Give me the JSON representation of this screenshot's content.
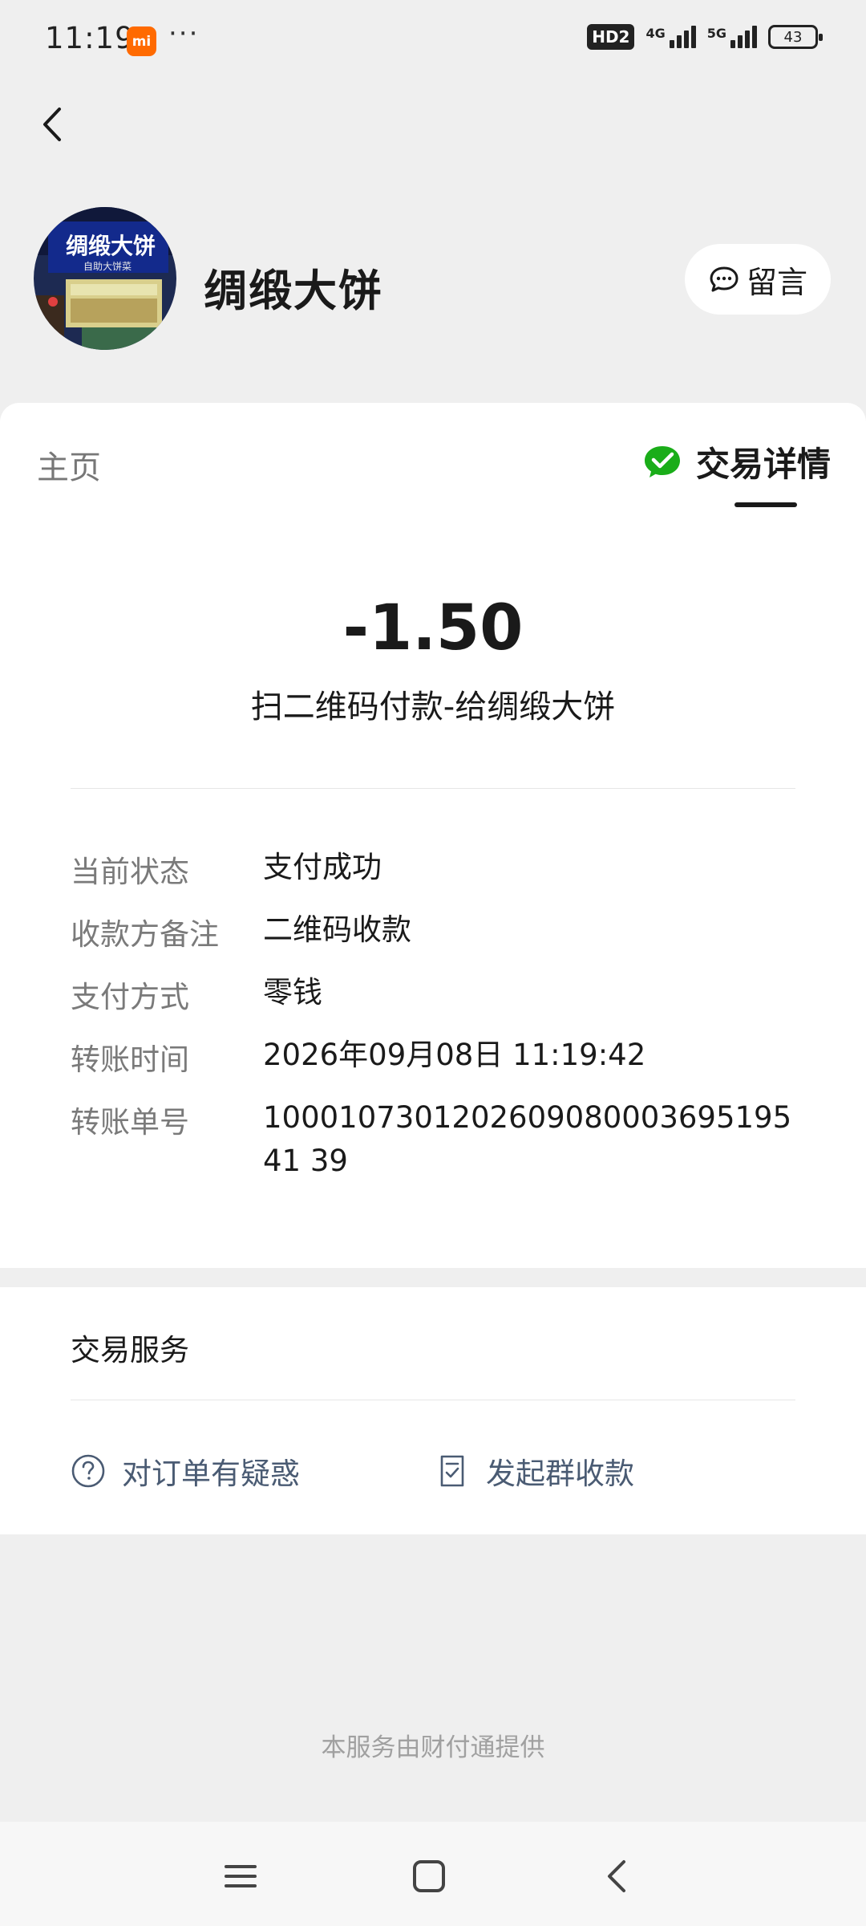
{
  "status_bar": {
    "time": "11:19",
    "mi_label": "mi",
    "more": "···",
    "hd_label": "HD2",
    "net1": "4G",
    "net2": "5G",
    "battery": "43"
  },
  "header": {
    "merchant_name": "绸缎大饼",
    "message_button": "留言",
    "avatar_sign_text": "绸缎大饼",
    "avatar_sub_text": "自助大饼菜"
  },
  "tabs": {
    "home": "主页",
    "detail": "交易详情"
  },
  "transaction": {
    "amount": "-1.50",
    "description": "扫二维码付款-给绸缎大饼",
    "rows": [
      {
        "label": "当前状态",
        "value": "支付成功"
      },
      {
        "label": "收款方备注",
        "value": "二维码收款"
      },
      {
        "label": "支付方式",
        "value": "零钱"
      },
      {
        "label": "转账时间",
        "value": "2026年09月08日 11:19:42"
      },
      {
        "label": "转账单号",
        "value": "100010730120260908000369519541 39"
      }
    ]
  },
  "services": {
    "title": "交易服务",
    "items": [
      {
        "label": "对订单有疑惑",
        "icon": "question-circle-icon"
      },
      {
        "label": "发起群收款",
        "icon": "receipt-icon"
      }
    ]
  },
  "footer": {
    "text": "本服务由财付通提供"
  },
  "colors": {
    "wechat_green": "#1aad19",
    "link_blue_gray": "#4a5b73",
    "background": "#efefef"
  }
}
